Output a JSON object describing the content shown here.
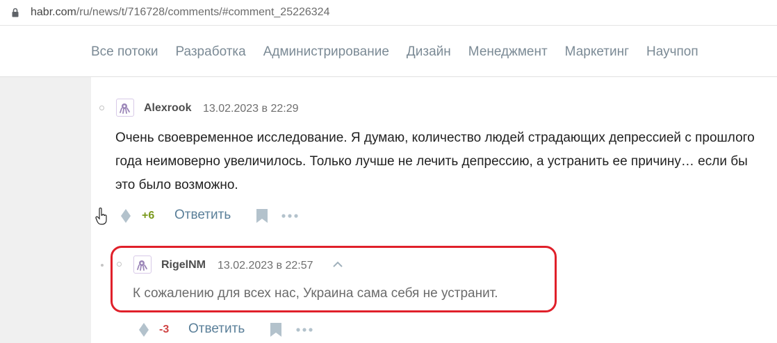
{
  "browser": {
    "url_host": "habr.com",
    "url_path": "/ru/news/t/716728/comments/#comment_25226324"
  },
  "nav": {
    "items": [
      "Все потоки",
      "Разработка",
      "Администрирование",
      "Дизайн",
      "Менеджмент",
      "Маркетинг",
      "Научпоп"
    ]
  },
  "comments": [
    {
      "author": "Alexrook",
      "time": "13.02.2023 в 22:29",
      "text": "Очень своевременное исследование. Я думаю, количество людей страдающих депрессией с прошлого года неимоверно увеличилось. Только лучше не лечить депрессию, а устранить ее причину… если бы это было возможно.",
      "score": "+6",
      "reply_label": "Ответить"
    },
    {
      "author": "RigelNM",
      "time": "13.02.2023 в 22:57",
      "text": "К сожалению для всех нас, Украина сама себя не устранит.",
      "score": "-3",
      "reply_label": "Ответить"
    }
  ],
  "colors": {
    "score_positive": "#7b9a1e",
    "score_negative": "#d04545",
    "highlight": "#e0202a"
  },
  "icons": [
    "lock-icon",
    "avatar-icon",
    "vote-icon",
    "bookmark-icon",
    "more-icon",
    "collapse-chevron-icon",
    "hand-cursor-icon"
  ]
}
